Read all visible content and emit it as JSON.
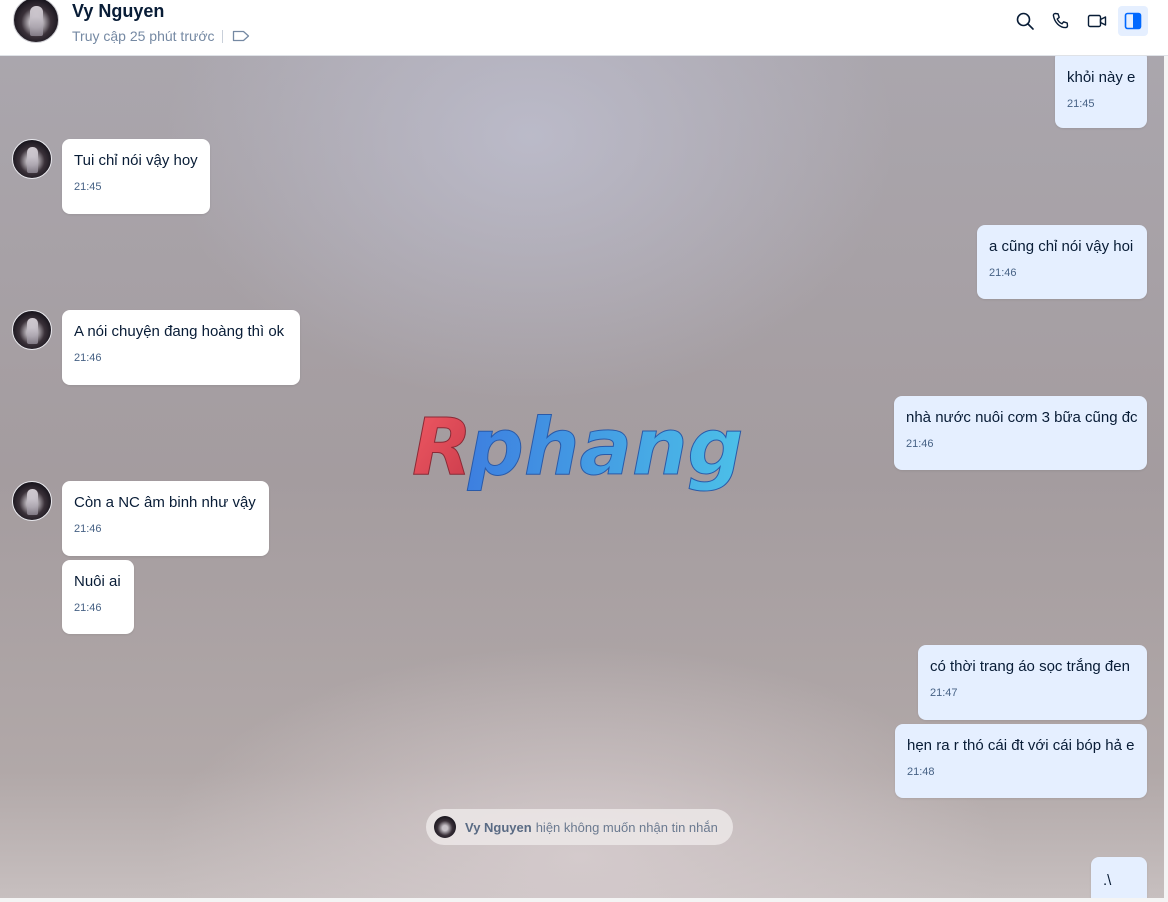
{
  "header": {
    "name": "Vy Nguyen",
    "status": "Truy cập 25 phút trước",
    "actions": {
      "search_icon": "search-icon",
      "call_icon": "phone-icon",
      "video_icon": "video-camera-icon",
      "panel_icon": "sidebar-toggle-icon"
    },
    "accent": "#0068ff"
  },
  "messages": [
    {
      "dir": "out",
      "text": "khỏi này e",
      "time": "21:45"
    },
    {
      "dir": "in",
      "text": "Tui chỉ nói vậy hoy",
      "time": "21:45"
    },
    {
      "dir": "out",
      "text": "a cũng chỉ nói vậy hoi",
      "time": "21:46"
    },
    {
      "dir": "in",
      "text": "A nói chuyện đang hoàng thì ok",
      "time": "21:46"
    },
    {
      "dir": "out",
      "text": "nhà nước nuôi cơm 3 bữa cũng đc",
      "time": "21:46"
    },
    {
      "dir": "in",
      "text": "Còn a NC âm binh như vậy",
      "time": "21:46"
    },
    {
      "dir": "in",
      "text": "Nuôi ai",
      "time": "21:46"
    },
    {
      "dir": "out",
      "text": "có thời trang áo sọc trắng đen",
      "time": "21:47"
    },
    {
      "dir": "out",
      "text": "hẹn ra r thó cái đt với cái bóp hả e",
      "time": "21:48"
    },
    {
      "dir": "out",
      "text": ".\\",
      "time": ""
    }
  ],
  "notice": {
    "name": "Vy Nguyen",
    "text": "hiện không muốn nhận tin nhắn"
  },
  "watermark": {
    "text": "Rphang"
  },
  "colors": {
    "incoming_bubble": "#ffffff",
    "outgoing_bubble": "#e5efff",
    "text": "#081c36",
    "time": "#476285"
  }
}
